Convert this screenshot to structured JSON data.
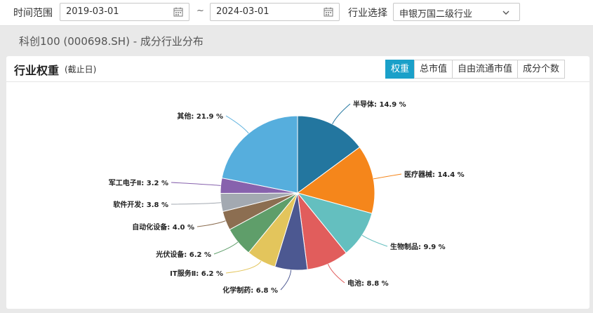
{
  "filters": {
    "time_label": "时间范围",
    "start_date": "2019-03-01",
    "separator": "~",
    "end_date": "2024-03-01",
    "industry_label": "行业选择",
    "industry_value": "申银万国二级行业"
  },
  "page_title": "科创100 (000698.SH) - 成分行业分布",
  "card": {
    "title": "行业权重",
    "subtitle": "(截止日)",
    "tabs": [
      {
        "label": "权重",
        "active": true
      },
      {
        "label": "总市值",
        "active": false
      },
      {
        "label": "自由流通市值",
        "active": false
      },
      {
        "label": "成分个数",
        "active": false
      }
    ]
  },
  "chart_data": {
    "type": "pie",
    "title": "",
    "unit": "%",
    "slices": [
      {
        "name": "半导体",
        "value": 14.9,
        "label": "半导体: 14.9 %",
        "color": "#23769f"
      },
      {
        "name": "医疗器械",
        "value": 14.4,
        "label": "医疗器械: 14.4 %",
        "color": "#f5861b"
      },
      {
        "name": "生物制品",
        "value": 9.9,
        "label": "生物制品: 9.9 %",
        "color": "#64bfbf"
      },
      {
        "name": "电池",
        "value": 8.8,
        "label": "电池: 8.8 %",
        "color": "#e15d5c"
      },
      {
        "name": "化学制药",
        "value": 6.8,
        "label": "化学制药: 6.8 %",
        "color": "#4c5891"
      },
      {
        "name": "IT服务Ⅱ",
        "value": 6.2,
        "label": "IT服务Ⅱ: 6.2 %",
        "color": "#e3c55c"
      },
      {
        "name": "光伏设备",
        "value": 6.2,
        "label": "光伏设备: 6.2 %",
        "color": "#5f9e6a"
      },
      {
        "name": "自动化设备",
        "value": 4.0,
        "label": "自动化设备: 4.0 %",
        "color": "#8c6e51"
      },
      {
        "name": "软件开发",
        "value": 3.8,
        "label": "软件开发: 3.8 %",
        "color": "#a3a9b1"
      },
      {
        "name": "军工电子Ⅱ",
        "value": 3.2,
        "label": "军工电子Ⅱ: 3.2 %",
        "color": "#8762ad"
      },
      {
        "name": "其他",
        "value": 21.9,
        "label": "其他: 21.9 %",
        "color": "#56aedd"
      }
    ]
  }
}
